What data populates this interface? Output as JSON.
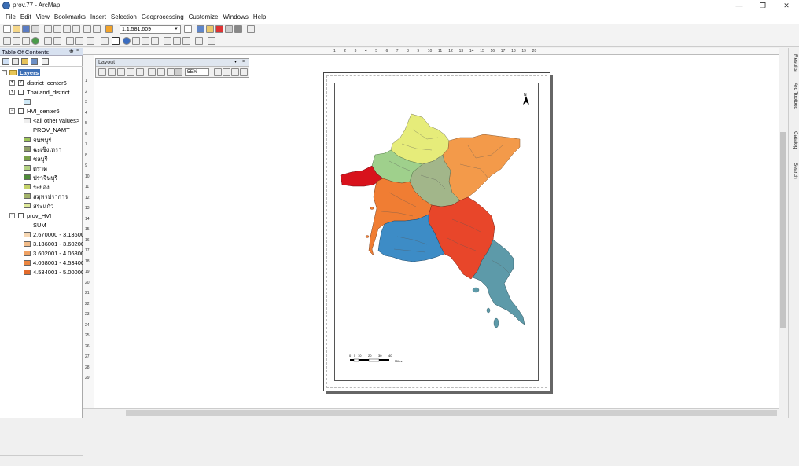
{
  "window": {
    "title": "prov.77 - ArcMap"
  },
  "menu": [
    "File",
    "Edit",
    "View",
    "Bookmarks",
    "Insert",
    "Selection",
    "Geoprocessing",
    "Customize",
    "Windows",
    "Help"
  ],
  "toolbar": {
    "scale": "1:1,581,609"
  },
  "toc": {
    "title": "Table Of Contents",
    "root": "Layers",
    "layers": [
      {
        "name": "district_center6",
        "checked": true,
        "expanded": false
      },
      {
        "name": "Thailand_district",
        "checked": false,
        "expanded": false
      },
      {
        "name": "HVI_center6",
        "checked": false,
        "expanded": true
      }
    ],
    "hvi_center6": {
      "all_other": "<all other values>",
      "field": "PROV_NAMT",
      "items": [
        {
          "label": "จันทบุรี",
          "color": "#9dc45a"
        },
        {
          "label": "ฉะเชิงเทรา",
          "color": "#8e9d68"
        },
        {
          "label": "ชลบุรี",
          "color": "#7aa04a"
        },
        {
          "label": "ตราด",
          "color": "#b3d183"
        },
        {
          "label": "ปราจีนบุรี",
          "color": "#4f8a3a"
        },
        {
          "label": "ระยอง",
          "color": "#c4d26a"
        },
        {
          "label": "สมุทรปราการ",
          "color": "#a3b36b"
        },
        {
          "label": "สระแก้ว",
          "color": "#dde89a"
        }
      ]
    },
    "prov_hvi": {
      "name": "prov_HVI",
      "field": "SUM",
      "classes": [
        {
          "label": "2.670000 - 3.136000",
          "color": "#f6d7b3"
        },
        {
          "label": "3.136001 - 3.602000",
          "color": "#f1bc8a"
        },
        {
          "label": "3.602001 - 4.068000",
          "color": "#eea163"
        },
        {
          "label": "4.068001 - 4.534000",
          "color": "#ea8540"
        },
        {
          "label": "4.534001 - 5.000000",
          "color": "#e26a2a"
        }
      ]
    }
  },
  "layout_toolbar": {
    "title": "Layout",
    "zoom": "55%"
  },
  "ruler_h": [
    "1",
    "2",
    "3",
    "4",
    "5",
    "6",
    "7",
    "8",
    "9",
    "10",
    "11",
    "12",
    "13",
    "14",
    "15",
    "16",
    "17",
    "18",
    "19",
    "20"
  ],
  "ruler_v": [
    "1",
    "2",
    "3",
    "4",
    "5",
    "6",
    "7",
    "8",
    "9",
    "10",
    "11",
    "12",
    "13",
    "14",
    "15",
    "16",
    "17",
    "18",
    "19",
    "20",
    "21",
    "22",
    "23",
    "24",
    "25",
    "26",
    "27",
    "28",
    "29"
  ],
  "scalebar": {
    "ticks": [
      "0",
      "5",
      "10",
      "20",
      "30",
      "40"
    ],
    "unit": "Miles"
  },
  "map_colors": {
    "yellow": "#e6ec7a",
    "orange": "#f39a4a",
    "sage": "#a2b68a",
    "lightgreen": "#9fd08c",
    "darkorange": "#f07d33",
    "red": "#e8462a",
    "blue": "#3d8cc6",
    "teal": "#5d9aa9",
    "crimson": "#d8121c"
  },
  "dock": [
    "Results",
    "Arc Toolbox",
    "Catalog",
    "Search"
  ]
}
